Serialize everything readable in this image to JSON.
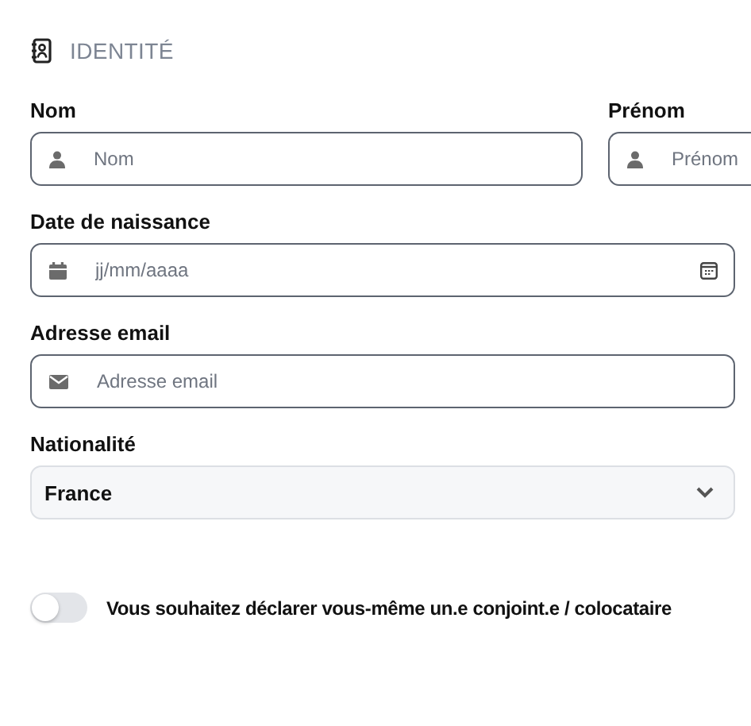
{
  "section": {
    "title": "IDENTITÉ"
  },
  "rows": [
    {
      "fields": [
        {
          "kind": "text",
          "label": "Nom",
          "placeholder": "Nom"
        },
        {
          "kind": "text",
          "label": "Prénom",
          "placeholder": "Prénom"
        }
      ]
    },
    {
      "fields": [
        {
          "kind": "date",
          "label": "Date de naissance",
          "placeholder": "jj/mm/aaaa"
        }
      ]
    },
    {
      "fields": [
        {
          "kind": "email",
          "label": "Adresse email",
          "placeholder": "Adresse email"
        }
      ]
    },
    {
      "fields": [
        {
          "kind": "select",
          "label": "Nationalité",
          "value": "France"
        }
      ]
    }
  ],
  "toggle": {
    "label": "Vous souhaitez déclarer vous-même un.e conjoint.e / colocataire",
    "on": false
  }
}
